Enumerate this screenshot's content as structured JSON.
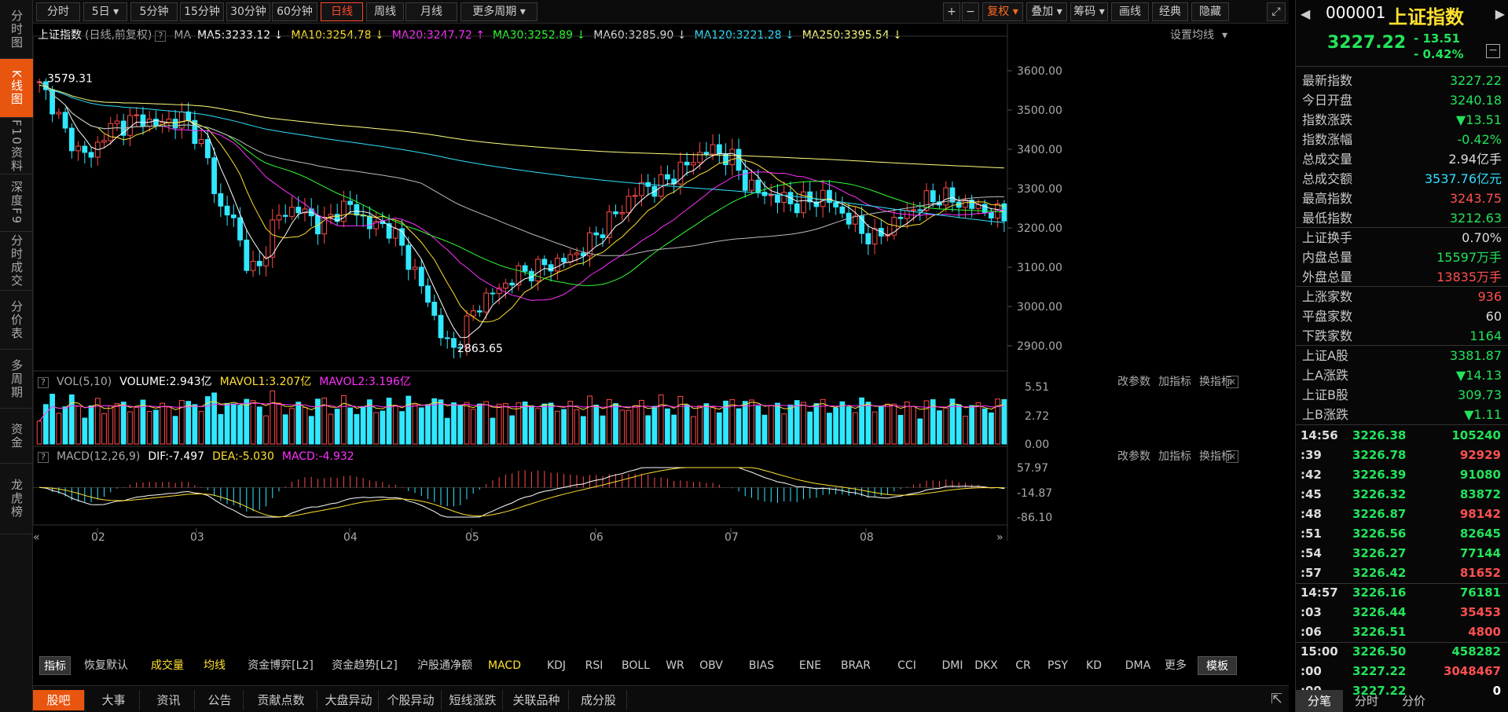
{
  "left_nav": [
    {
      "label": "分时图"
    },
    {
      "label": "K线图"
    },
    {
      "label": "F10资料"
    },
    {
      "label": "深度F9"
    },
    {
      "label": "分时成交"
    },
    {
      "label": "分价表"
    },
    {
      "label": "多周期"
    },
    {
      "label": "资金"
    },
    {
      "label": "龙虎榜"
    }
  ],
  "toolbar": {
    "periods": [
      "分时",
      "5日",
      "5分钟",
      "15分钟",
      "30分钟",
      "60分钟",
      "日线",
      "周线",
      "月线",
      "更多周期"
    ],
    "active_period": "日线",
    "right": [
      "复权",
      "叠加",
      "筹码",
      "画线",
      "经典",
      "隐藏"
    ]
  },
  "main_chart": {
    "name": "上证指数",
    "mode": "(日线,前复权)",
    "ma_label": "MA",
    "ma": [
      {
        "label": "MA5:3233.12",
        "color": "#ffffff"
      },
      {
        "label": "MA10:3254.78",
        "color": "#ffe030"
      },
      {
        "label": "MA20:3247.72",
        "color": "#ff30ff"
      },
      {
        "label": "MA30:3252.89",
        "color": "#30ff30"
      },
      {
        "label": "MA60:3285.90",
        "color": "#dddddd"
      },
      {
        "label": "MA120:3221.28",
        "color": "#30e0ff"
      },
      {
        "label": "MA250:3395.54",
        "color": "#ffff80"
      }
    ],
    "settings": "设置均线",
    "y_ticks": [
      "3600.00",
      "3500.00",
      "3400.00",
      "3300.00",
      "3200.00",
      "3100.00",
      "3000.00",
      "2900.00"
    ],
    "high_label": "3579.31",
    "low_label": "2863.65"
  },
  "volume": {
    "label": "VOL(5,10)",
    "volume": "VOLUME:2.943亿",
    "mavol1": "MAVOL1:3.207亿",
    "mavol2": "MAVOL2:3.196亿",
    "y_ticks": [
      "5.51",
      "2.72",
      "0.00"
    ],
    "actions": [
      "改参数",
      "加指标",
      "换指标"
    ]
  },
  "macd": {
    "label": "MACD(12,26,9)",
    "dif": "DIF:-7.497",
    "dea": "DEA:-5.030",
    "macd": "MACD:-4.932",
    "y_ticks": [
      "57.97",
      "-14.87",
      "-86.10"
    ],
    "actions": [
      "改参数",
      "加指标",
      "换指标"
    ]
  },
  "x_ticks": [
    "02",
    "03",
    "04",
    "05",
    "06",
    "07",
    "08"
  ],
  "indicator_tabs": [
    "指标",
    "恢复默认",
    "成交量",
    "均线",
    "资金博弈[L2]",
    "资金趋势[L2]",
    "沪股通净额",
    "MACD",
    "KDJ",
    "RSI",
    "BOLL",
    "WR",
    "OBV",
    "BIAS",
    "ENE",
    "BRAR",
    "CCI",
    "DMI",
    "DKX",
    "CR",
    "PSY",
    "KD",
    "DMA",
    "更多",
    "模板"
  ],
  "bottom_tabs": [
    "股吧",
    "大事",
    "资讯",
    "公告",
    "贡献点数",
    "大盘异动",
    "个股异动",
    "短线涨跌",
    "关联品种",
    "成分股"
  ],
  "right_panel": {
    "code": "000001",
    "name": "上证指数",
    "price": "3227.22",
    "change": "- 13.51",
    "change_pct": "- 0.42%",
    "stats": [
      {
        "k": "最新指数",
        "v": "3227.22",
        "c": "#22e35a"
      },
      {
        "k": "今日开盘",
        "v": "3240.18",
        "c": "#22e35a"
      },
      {
        "k": "指数涨跌",
        "v": "▼13.51",
        "c": "#22e35a"
      },
      {
        "k": "指数涨幅",
        "v": "-0.42%",
        "c": "#22e35a"
      },
      {
        "k": "总成交量",
        "v": "2.94亿手",
        "c": "#dddddd"
      },
      {
        "k": "总成交额",
        "v": "3537.76亿元",
        "c": "#30e0ff"
      },
      {
        "k": "最高指数",
        "v": "3243.75",
        "c": "#ff5050"
      },
      {
        "k": "最低指数",
        "v": "3212.63",
        "c": "#22e35a"
      },
      {
        "k": "上证换手",
        "v": "0.70%",
        "c": "#dddddd"
      },
      {
        "k": "内盘总量",
        "v": "15597万手",
        "c": "#22e35a"
      },
      {
        "k": "外盘总量",
        "v": "13835万手",
        "c": "#ff5050"
      },
      {
        "k": "上涨家数",
        "v": "936",
        "c": "#ff5050"
      },
      {
        "k": "平盘家数",
        "v": "60",
        "c": "#dddddd"
      },
      {
        "k": "下跌家数",
        "v": "1164",
        "c": "#22e35a"
      },
      {
        "k": "上证A股",
        "v": "3381.87",
        "c": "#22e35a"
      },
      {
        "k": "上A涨跌",
        "v": "▼14.13",
        "c": "#22e35a"
      },
      {
        "k": "上证B股",
        "v": "309.73",
        "c": "#22e35a"
      },
      {
        "k": "上B涨跌",
        "v": "▼1.11",
        "c": "#22e35a"
      }
    ],
    "ticks": [
      {
        "t": "14:56",
        "p": "3226.38",
        "v": "105240",
        "c": "#22e35a"
      },
      {
        "t": ":39",
        "p": "3226.78",
        "v": "92929",
        "c": "#ff5050"
      },
      {
        "t": ":42",
        "p": "3226.39",
        "v": "91080",
        "c": "#22e35a"
      },
      {
        "t": ":45",
        "p": "3226.32",
        "v": "83872",
        "c": "#22e35a"
      },
      {
        "t": ":48",
        "p": "3226.87",
        "v": "98142",
        "c": "#ff5050"
      },
      {
        "t": ":51",
        "p": "3226.56",
        "v": "82645",
        "c": "#22e35a"
      },
      {
        "t": ":54",
        "p": "3226.27",
        "v": "77144",
        "c": "#22e35a"
      },
      {
        "t": ":57",
        "p": "3226.42",
        "v": "81652",
        "c": "#ff5050"
      },
      {
        "t": "14:57",
        "p": "3226.16",
        "v": "76181",
        "c": "#22e35a"
      },
      {
        "t": ":03",
        "p": "3226.44",
        "v": "35453",
        "c": "#ff5050"
      },
      {
        "t": ":06",
        "p": "3226.51",
        "v": "4800",
        "c": "#ff5050"
      },
      {
        "t": "15:00",
        "p": "3226.50",
        "v": "458282",
        "c": "#22e35a"
      },
      {
        "t": ":00",
        "p": "3227.22",
        "v": "3048467",
        "c": "#ff5050"
      },
      {
        "t": ":00",
        "p": "3227.22",
        "v": "0",
        "c": "#ffffff"
      }
    ],
    "tabs": [
      "分笔",
      "分时",
      "分价"
    ]
  },
  "chart_data": {
    "type": "candlestick",
    "price_range": [
      2840,
      3640
    ],
    "volume_range": [
      0,
      5.51
    ],
    "macd_range": [
      -86.1,
      57.97
    ],
    "key_points": [
      {
        "label": "3579.31",
        "value": 3579.31
      },
      {
        "label": "2863.65",
        "value": 2863.65
      }
    ],
    "close_path": [
      3560,
      3520,
      3440,
      3400,
      3380,
      3440,
      3460,
      3470,
      3480,
      3460,
      3470,
      3480,
      3450,
      3380,
      3250,
      3230,
      3120,
      3080,
      3200,
      3240,
      3250,
      3230,
      3200,
      3240,
      3260,
      3230,
      3200,
      3210,
      3160,
      3100,
      3030,
      2950,
      2880,
      2940,
      3000,
      3030,
      3050,
      3080,
      3090,
      3100,
      3110,
      3120,
      3140,
      3170,
      3210,
      3240,
      3280,
      3310,
      3300,
      3330,
      3350,
      3380,
      3400,
      3390,
      3370,
      3310,
      3290,
      3280,
      3270,
      3260,
      3270,
      3280,
      3250,
      3220,
      3190,
      3170,
      3200,
      3230,
      3250,
      3270,
      3280,
      3270,
      3260,
      3250,
      3240,
      3227
    ]
  }
}
